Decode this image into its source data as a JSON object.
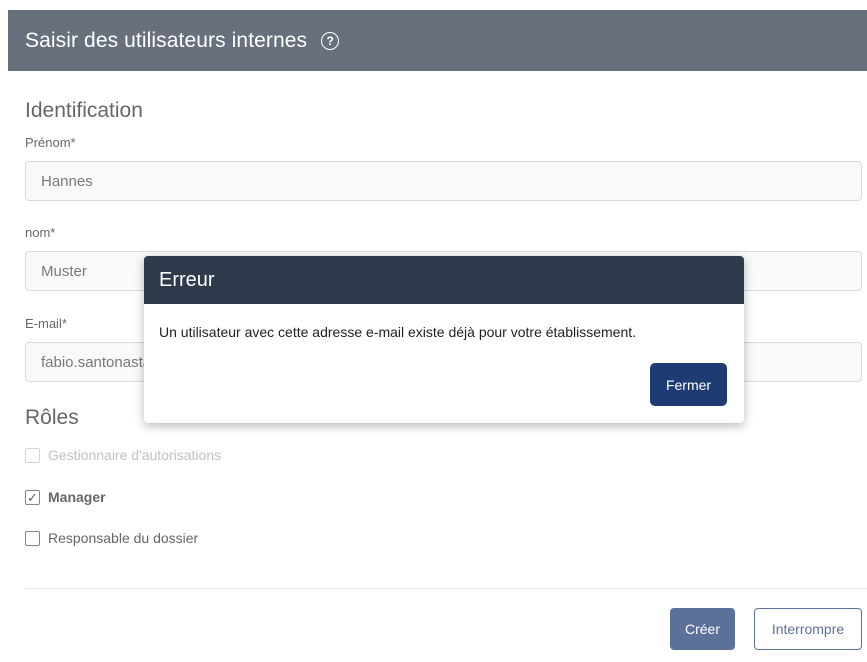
{
  "header": {
    "title": "Saisir des utilisateurs internes",
    "help_icon": "question-circle-icon",
    "help_glyph": "?"
  },
  "identification": {
    "title": "Identification",
    "first_name": {
      "label": "Prénom*",
      "value": "Hannes"
    },
    "last_name": {
      "label": "nom*",
      "value": "Muster"
    },
    "email": {
      "label": "E-mail*",
      "value": "fabio.santonastaso@example.com"
    }
  },
  "roles": {
    "title": "Rôles",
    "items": [
      {
        "label": "Gestionnaire d'autorisations",
        "checked": false,
        "disabled": true
      },
      {
        "label": "Manager",
        "checked": true,
        "disabled": false
      },
      {
        "label": "Responsable du dossier",
        "checked": false,
        "disabled": false
      }
    ]
  },
  "footer": {
    "create_label": "Créer",
    "cancel_label": "Interrompre"
  },
  "error_dialog": {
    "title": "Erreur",
    "message": "Un utilisateur avec cette adresse e-mail existe déjà pour votre établissement.",
    "close_label": "Fermer"
  },
  "colors": {
    "header_bg": "#2f3a4d",
    "primary": "#1e3b74"
  }
}
